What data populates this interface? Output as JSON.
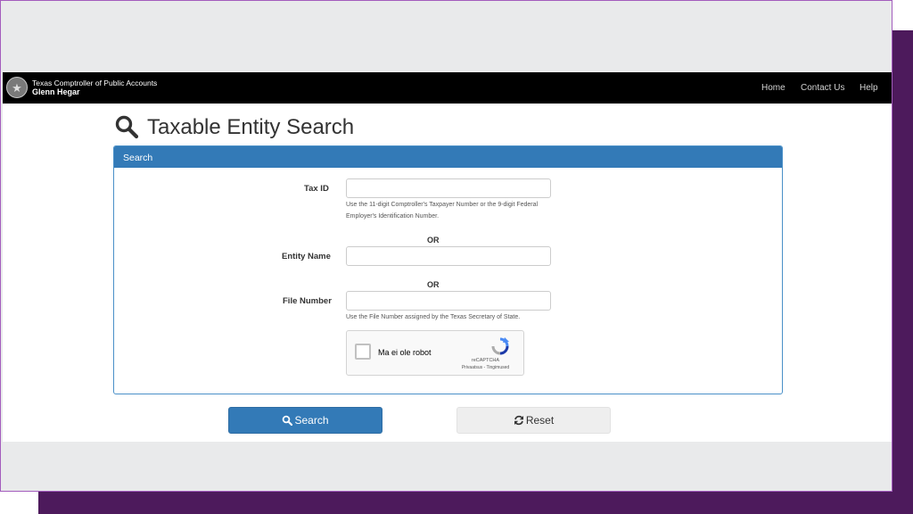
{
  "header": {
    "agency_line": "Texas Comptroller of Public Accounts",
    "official_name": "Glenn Hegar",
    "seal_icon": "state-seal-icon",
    "nav": [
      "Home",
      "Contact Us",
      "Help"
    ]
  },
  "page": {
    "title": "Taxable Entity Search",
    "title_icon": "search-icon"
  },
  "panel": {
    "heading": "Search",
    "tax_id": {
      "label": "Tax ID",
      "value": "",
      "help_line1": "Use the 11-digit Comptroller's Taxpayer Number or the 9-digit Federal",
      "help_line2": "Employer's Identification Number."
    },
    "or_1": "OR",
    "entity_name": {
      "label": "Entity Name",
      "value": ""
    },
    "or_2": "OR",
    "file_number": {
      "label": "File Number",
      "value": "",
      "help": "Use the File Number assigned by the Texas Secretary of State."
    },
    "recaptcha": {
      "label": "Ma ei ole robot",
      "brand": "reCAPTCHA",
      "terms": "Privaatsus - Tingimused",
      "checked": false
    }
  },
  "buttons": {
    "search": "Search",
    "reset": "Reset"
  },
  "colors": {
    "navbar": "#000000",
    "primary": "#337ab7",
    "frame_border": "#a35dbd",
    "frame_shadow": "#4d1a5c",
    "backdrop": "#e9eaeb"
  }
}
